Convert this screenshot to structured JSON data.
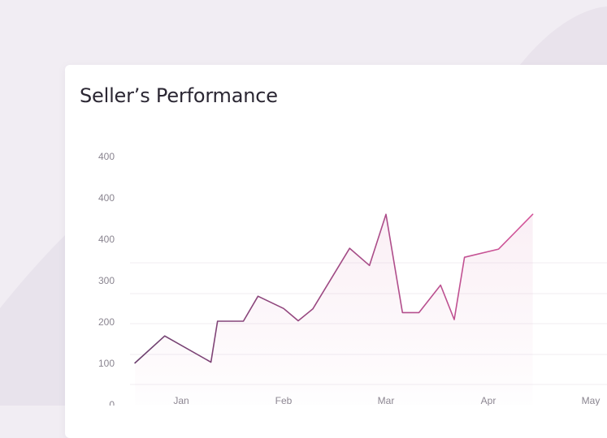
{
  "card": {
    "title": "Seller’s Performance"
  },
  "colors": {
    "line_start": "#6b3f6e",
    "line_end": "#d4559a",
    "area_fill": "#e9b7d2",
    "gridline": "#f0ecf2",
    "page_bg": "#f1edf3"
  },
  "chart_data": {
    "type": "line",
    "title": "Seller’s Performance",
    "xlabel": "",
    "ylabel": "",
    "y_tick_labels": [
      "0",
      "100",
      "200",
      "300",
      "400",
      "400",
      "400"
    ],
    "x_tick_labels": [
      "Jan",
      "Feb",
      "Mar",
      "Apr",
      "May"
    ],
    "grid": true,
    "legend": "none",
    "series": [
      {
        "values": [
          {
            "x": "Jan 1",
            "y": 102
          },
          {
            "x": "Jan 10",
            "y": 168
          },
          {
            "x": "Jan 24",
            "y": 104
          },
          {
            "x": "Jan 26",
            "y": 204
          },
          {
            "x": "Feb 4",
            "y": 204
          },
          {
            "x": "Feb 8",
            "y": 265
          },
          {
            "x": "Feb 15",
            "y": 235
          },
          {
            "x": "Feb 19",
            "y": 205
          },
          {
            "x": "Feb 23",
            "y": 234
          },
          {
            "x": "Mar 4",
            "y": 382
          },
          {
            "x": "Mar 10",
            "y": 340
          },
          {
            "x": "Mar 15",
            "y": 465
          },
          {
            "x": "Mar 20",
            "y": 225
          },
          {
            "x": "Mar 25",
            "y": 225
          },
          {
            "x": "Apr 1",
            "y": 292
          },
          {
            "x": "Apr 5",
            "y": 208
          },
          {
            "x": "Apr 8",
            "y": 360
          },
          {
            "x": "Apr 18",
            "y": 380
          },
          {
            "x": "Apr 28",
            "y": 465
          }
        ]
      }
    ]
  }
}
